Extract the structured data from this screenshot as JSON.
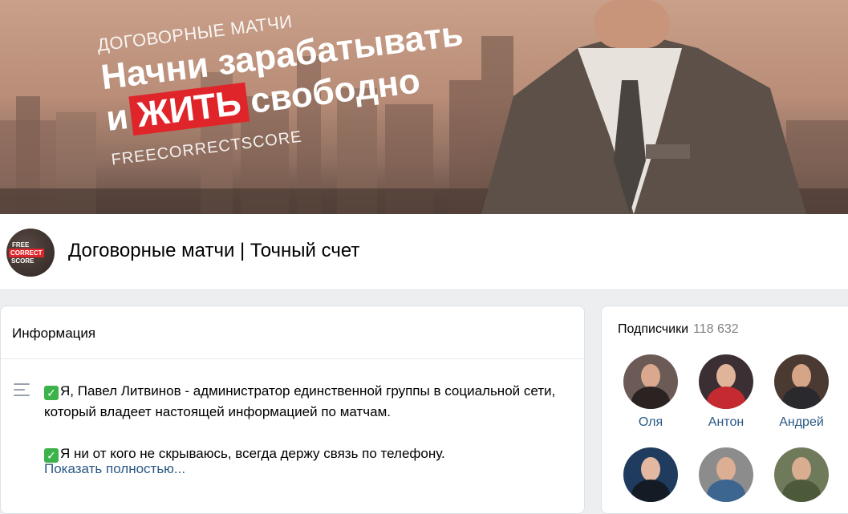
{
  "cover": {
    "kicker": "ДОГОВОРНЫЕ МАТЧИ",
    "headline_line1": "Начни зарабатывать",
    "headline_prefix": "и",
    "headline_highlight": "ЖИТЬ",
    "headline_suffix": "свободно",
    "brand": "FREECORRECTSCORE"
  },
  "group": {
    "avatar_lines": [
      "FREE",
      "CORRECT",
      "SCORE"
    ],
    "title": "Договорные матчи | Точный счет"
  },
  "info": {
    "heading": "Информация",
    "paragraphs": [
      "Я, Павел Литвинов - администратор единственной группы в социальной сети, который владеет настоящей информацией по матчам.",
      "Я ни от кого не скрываюсь, всегда держу связь по телефону."
    ],
    "check_icon": "check-mark-icon",
    "show_more": "Показать полностью..."
  },
  "subscribers": {
    "heading": "Подписчики",
    "count": "118 632",
    "members": [
      {
        "name": "Оля",
        "bg": "#6b5a55"
      },
      {
        "name": "Антон",
        "bg": "#3b2f33"
      },
      {
        "name": "Андрей",
        "bg": "#4a3a32"
      },
      {
        "name": "",
        "bg": "#1f3b5e"
      },
      {
        "name": "",
        "bg": "#8c8c8c"
      },
      {
        "name": "",
        "bg": "#6e7a5a"
      }
    ]
  },
  "colors": {
    "link": "#2a5885",
    "accent_red": "#e0252a",
    "check_green": "#3bb24a",
    "page_bg": "#edeef0"
  }
}
